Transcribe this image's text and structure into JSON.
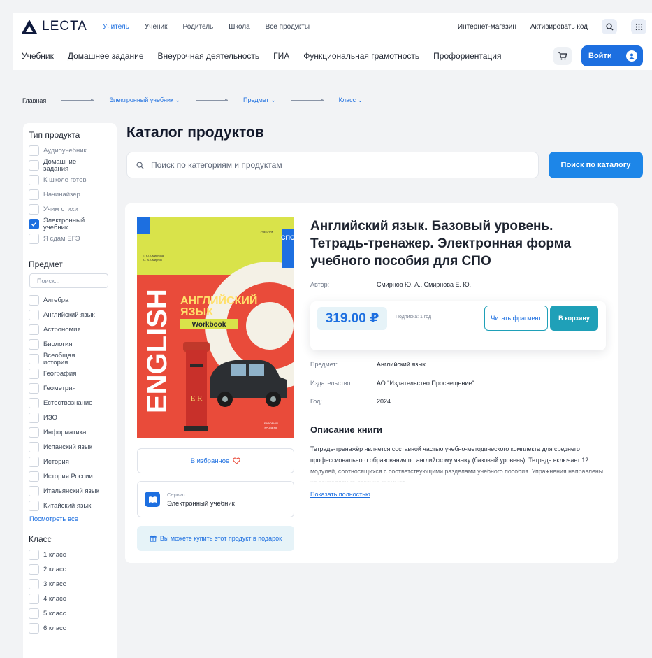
{
  "header": {
    "logo_text": "LECTA",
    "roles": [
      "Учитель",
      "Ученик",
      "Родитель",
      "Школа",
      "Все продукты"
    ],
    "shop_link": "Интернет-магазин",
    "activate_link": "Активировать код"
  },
  "nav": {
    "links": [
      "Учебник",
      "Домашнее задание",
      "Внеурочная деятельность",
      "ГИА",
      "Функциональная грамотность",
      "Профориентация"
    ],
    "login_label": "Войти"
  },
  "breadcrumb": {
    "home": "Главная",
    "items": [
      "Электронный учебник",
      "Предмет",
      "Класс"
    ]
  },
  "filters": {
    "type_title": "Тип продукта",
    "types": [
      "Аудиоучебник",
      "Домашние задания",
      "К школе готов",
      "Начинайзер",
      "Учим стихи",
      "Электронный учебник",
      "Я сдам ЕГЭ"
    ],
    "subject_title": "Предмет",
    "subject_search_placeholder": "Поиск...",
    "subjects": [
      "Алгебра",
      "Английский язык",
      "Астрономия",
      "Биология",
      "Всеобщая история",
      "География",
      "Геометрия",
      "Естествознание",
      "ИЗО",
      "Информатика",
      "Испанский язык",
      "История",
      "История России",
      "Итальянский язык",
      "Китайский язык"
    ],
    "show_all": "Посмотреть все",
    "class_title": "Класс",
    "classes": [
      "1 класс",
      "2 класс",
      "3 класс",
      "4 класс",
      "5 класс",
      "6 класс"
    ]
  },
  "main": {
    "title": "Каталог продуктов",
    "search_placeholder": "Поиск по категориям и продуктам",
    "search_button": "Поиск по каталогу"
  },
  "product": {
    "title": "Английский язык. Базовый уровень. Тетрадь-тренажер. Электронная форма учебного пособия для СПО",
    "author_label": "Автор:",
    "author": "Смирнов Ю. А., Смирнова Е. Ю.",
    "price": "319.00 ₽",
    "subscription": "Подписка: 1 год",
    "read_fragment": "Читать фрагмент",
    "to_cart": "В корзину",
    "subject_label": "Предмет:",
    "subject": "Английский язык",
    "publisher_label": "Издательство:",
    "publisher": "АО \"Издательство Просвещение\"",
    "year_label": "Год:",
    "year": "2024",
    "desc_title": "Описание книги",
    "description": "Тетрадь-тренажёр является составной частью учебно-методического комплекта для среднего профессионального образования по английскому языку (базовый уровень). Тетрадь включает 12 модулей, соотносящихся с соответствующими разделами учебного пособия. Упражнения направлены на закрепление лексико-граммат",
    "show_full": "Показать полностью",
    "favorite": "В избранное",
    "service_label": "Сервис",
    "service_value": "Электронный учебник",
    "gift": "Вы можете купить этот продукт в подарок",
    "cover": {
      "authors": "Е. Ю. Смирнова\nЮ. А. Смирнов",
      "spine": "ENGLISH",
      "title": "АНГЛИЙСКИЙ\nЯЗЫК",
      "subtitle": "Workbook",
      "badge_top": "УЧЕБНИК",
      "badge_letters": "СПО",
      "level": "БАЗОВЫЙ\nУРОВЕНЬ",
      "postbox_text": "E R"
    }
  },
  "colors": {
    "accent": "#1d6fe0",
    "teal": "#1fa0b8",
    "cover_red": "#e94b3a",
    "cover_yellow": "#d9e34a"
  }
}
